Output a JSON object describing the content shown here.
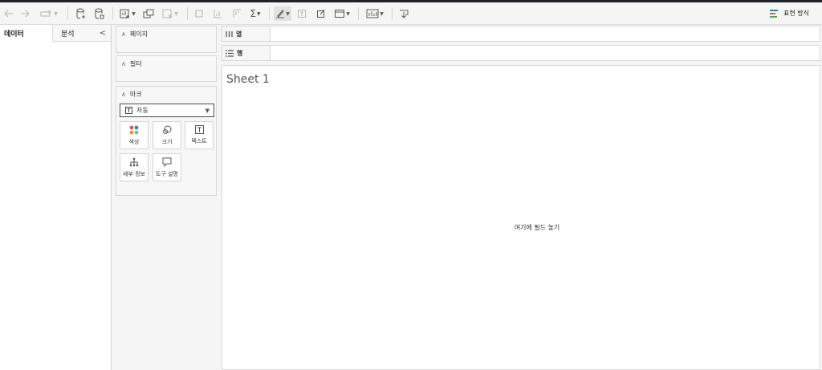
{
  "toolbar": {
    "icons": [
      "back-arrow-icon",
      "forward-arrow-icon",
      "redo-icon",
      "new-datasource-icon",
      "pause-update-icon",
      "new-sheet-icon",
      "duplicate-sheet-icon",
      "clear-sheet-icon",
      "swap-axes-icon",
      "sort-ascending-icon",
      "sort-descending-icon",
      "sum-icon",
      "highlight-icon",
      "labels-icon",
      "annotate-icon",
      "fit-icon",
      "show-cards-icon",
      "share-icon"
    ],
    "sum_symbol": "Σ",
    "present_label": "표현 방식"
  },
  "left_pane": {
    "tab_data": "데이터",
    "tab_analysis": "분석",
    "collapse_symbol": "<"
  },
  "cards": {
    "pages": {
      "title": "페이지"
    },
    "filters": {
      "title": "필터"
    },
    "marks": {
      "title": "마크",
      "mark_type": "자동",
      "buttons": {
        "color": "색상",
        "size": "크기",
        "text": "텍스트",
        "detail": "세부 정보",
        "tooltip": "도구 설명"
      }
    }
  },
  "shelves": {
    "columns_label": "열",
    "rows_label": "행"
  },
  "view": {
    "sheet_title": "Sheet 1",
    "drop_hint": "여기에 필드 놓기"
  },
  "colors": {
    "chrome_dark": "#1e2329",
    "panel_bg": "#f5f5f5",
    "color_dots": [
      "#e15759",
      "#4e79a7",
      "#f28e2b",
      "#76b7b2"
    ],
    "present_bars": [
      "#4e79a7",
      "#e15759",
      "#59a14f"
    ]
  }
}
